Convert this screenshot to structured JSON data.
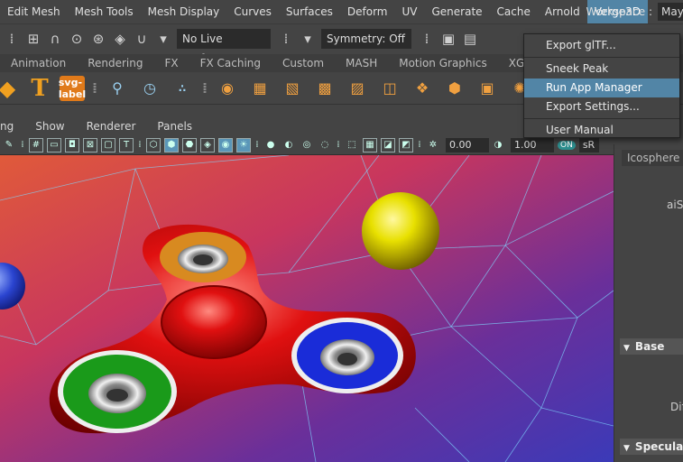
{
  "main_menu": [
    "Edit Mesh",
    "Mesh Tools",
    "Mesh Display",
    "Curves",
    "Surfaces",
    "Deform",
    "UV",
    "Generate",
    "Cache",
    "Arnold",
    "Verge3D"
  ],
  "workspace": {
    "label": "Workspace :",
    "value": "Maya"
  },
  "status_line": {
    "live_surface": "No Live Surface",
    "symmetry": "Symmetry: Off",
    "icons": [
      "snap-grid-icon",
      "snap-curve-icon",
      "snap-point-icon",
      "snap-view-icon",
      "snap-surface-icon",
      "magnet-icon",
      "render-view-icon",
      "render-sequence-icon"
    ]
  },
  "shelf_tabs": [
    "Animation",
    "Rendering",
    "FX",
    "FX Caching",
    "Custom",
    "MASH",
    "Motion Graphics",
    "XGen"
  ],
  "shelf_icons": [
    "svg-label"
  ],
  "panel_menu": [
    "ng",
    "Show",
    "Renderer",
    "Panels"
  ],
  "panel_toolbar": {
    "field_a": "0.00",
    "field_b": "1.00",
    "colorspace": "sR"
  },
  "attribute_editor": {
    "tab": "Icosphere",
    "node": "aiSt",
    "sections": [
      "Base",
      "Specula"
    ],
    "row_label": "Dif"
  },
  "verge3d_menu": {
    "items": [
      {
        "label": "Export glTF..."
      },
      {
        "label": "Sneek Peak"
      },
      {
        "label": "Run App Manager",
        "highlighted": true
      },
      {
        "label": "Export Settings..."
      },
      {
        "label": "User Manual"
      }
    ]
  },
  "colors": {
    "accent": "#5285a6",
    "ui_bg": "#444444",
    "field_bg": "#2b2b2b"
  }
}
